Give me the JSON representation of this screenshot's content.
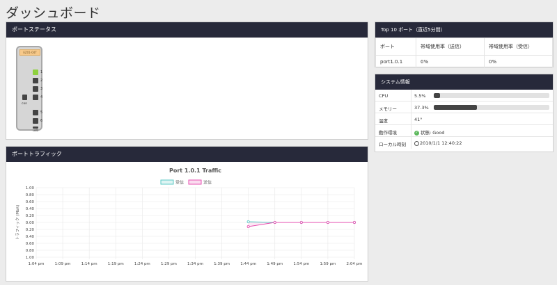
{
  "page_title": "ダッシュボード",
  "port_status": {
    "header": "ポートステータス",
    "device_model": "EZ01-04T",
    "ports": [
      {
        "num": "1",
        "status": "up"
      },
      {
        "num": "2",
        "status": "down"
      },
      {
        "num": "3",
        "status": "down"
      },
      {
        "num": "4",
        "status": "down"
      },
      {
        "num": "5",
        "status": "down"
      },
      {
        "num": "6",
        "status": "down"
      }
    ],
    "con_label": "con",
    "usb_label": "usb"
  },
  "top10": {
    "header": "Top 10 ポート（直近5分間）",
    "columns": [
      "ポート",
      "帯域使用率（送信）",
      "帯域使用率（受信）"
    ],
    "rows": [
      [
        "port1.0.1",
        "0%",
        "0%"
      ]
    ]
  },
  "system_info": {
    "header": "システム情報",
    "cpu_label": "CPU",
    "cpu_value": "5.5%",
    "cpu_fraction": 0.055,
    "memory_label": "メモリー",
    "memory_value": "37.3%",
    "memory_fraction": 0.373,
    "temp_label": "温度",
    "temp_value": "41°",
    "env_label": "動作環境",
    "env_value": "状態: Good",
    "time_label": "ローカル時刻",
    "time_value": "2010/1/1 12:40:22"
  },
  "traffic": {
    "header": "ポートトラフィック"
  },
  "chart_data": {
    "type": "line",
    "title": "Port 1.0.1 Traffic",
    "ylabel": "トラフィック (Mbit)",
    "xlabel": "",
    "x": [
      "1:04 pm",
      "1:09 pm",
      "1:14 pm",
      "1:19 pm",
      "1:24 pm",
      "1:29 pm",
      "1:34 pm",
      "1:39 pm",
      "1:44 pm",
      "1:49 pm",
      "1:54 pm",
      "1:59 pm",
      "2:04 pm"
    ],
    "y_ticks": [
      "1.00",
      "0.80",
      "0.60",
      "0.40",
      "0.20",
      "0.00",
      "0.20",
      "0.40",
      "0.60",
      "0.80",
      "1.00"
    ],
    "ylim": [
      -1,
      1
    ],
    "legend_position": "top",
    "series": [
      {
        "name": "受信",
        "color": "#5bc8c4",
        "points": [
          [
            8,
            0.02
          ],
          [
            9,
            0.0
          ],
          [
            10,
            0.0
          ],
          [
            11,
            0.0
          ],
          [
            12,
            0.0
          ]
        ]
      },
      {
        "name": "送信",
        "color": "#e64fb0",
        "points": [
          [
            8,
            -0.12
          ],
          [
            9,
            0.0
          ],
          [
            10,
            0.0
          ],
          [
            11,
            0.0
          ],
          [
            12,
            0.0
          ]
        ]
      }
    ]
  }
}
